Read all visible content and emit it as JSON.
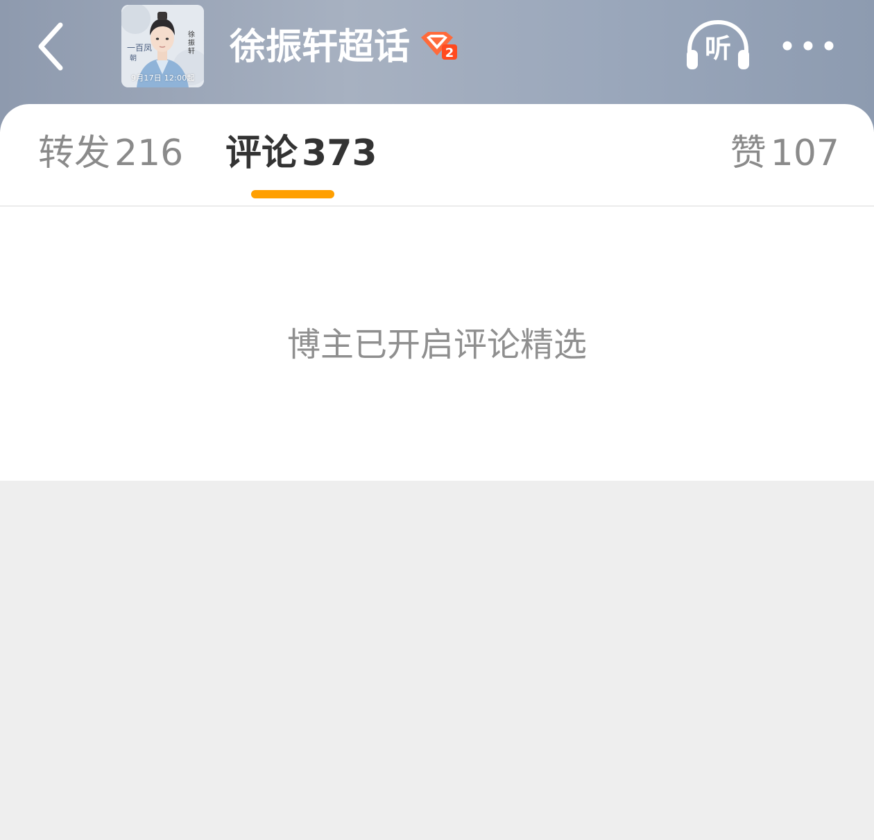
{
  "header": {
    "back_icon": "chevron-left-icon",
    "avatar_caption": "9月17日 12:00起",
    "title": "徐振轩超话",
    "level_badge_icon": "diamond-level-badge-icon",
    "level_badge_color": "#ff5a2b",
    "listen_label": "听",
    "more_icon": "more-dots-icon"
  },
  "tabs": [
    {
      "label": "转发",
      "count": "216",
      "active": false
    },
    {
      "label": "评论",
      "count": "373",
      "active": true
    },
    {
      "label": "赞",
      "count": "107",
      "active": false
    }
  ],
  "tab_indicator_color": "#ff9f00",
  "notice": "博主已开启评论精选"
}
